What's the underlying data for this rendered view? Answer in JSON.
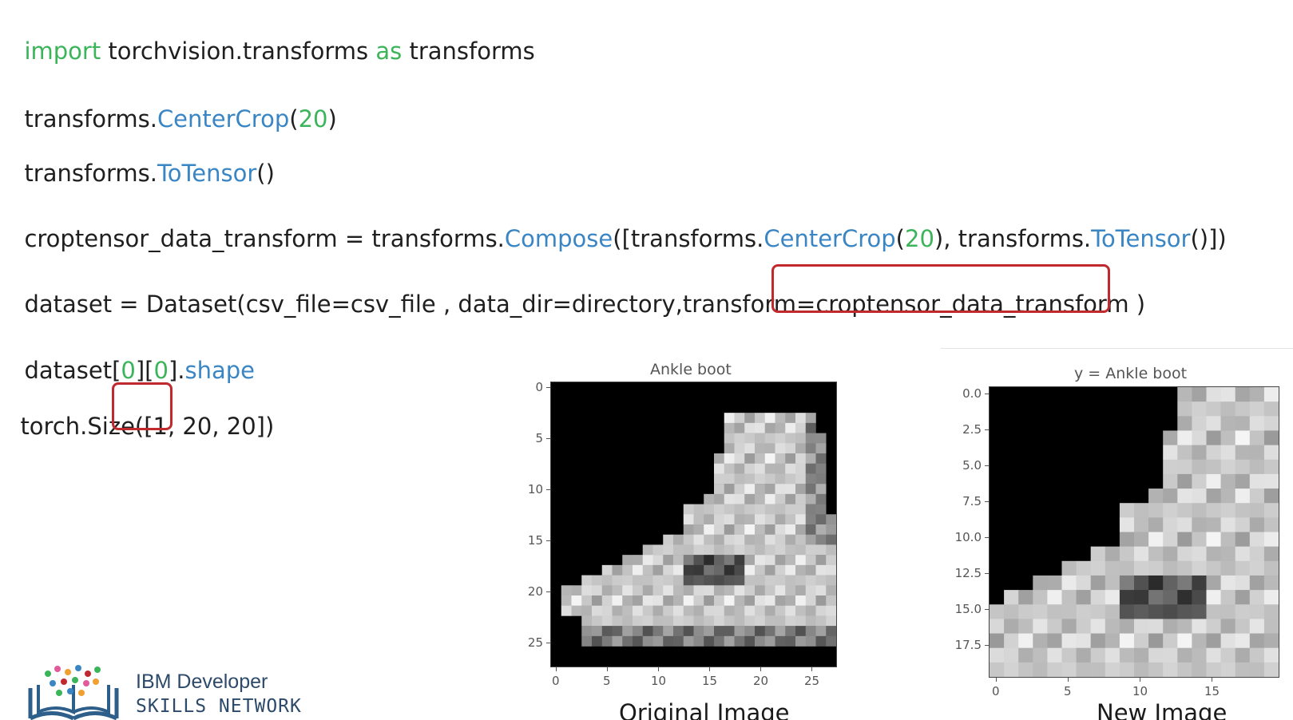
{
  "code": {
    "line1": {
      "kw1": "import",
      "t1": " torchvision.transforms ",
      "kw2": "as",
      "t2": " transforms"
    },
    "line2": {
      "t1": "transforms.",
      "fn": "CenterCrop",
      "p1": "(",
      "num": "20",
      "p2": ")"
    },
    "line3": {
      "t1": "transforms.",
      "fn": "ToTensor",
      "p1": "()"
    },
    "line4": {
      "t1": "croptensor_data_transform = transforms.",
      "fn1": "Compose",
      "t2": "([transforms.",
      "fn2": "CenterCrop",
      "p1": "(",
      "num": "20",
      "t3": "), transforms.",
      "fn3": "ToTensor",
      "t4": "()])"
    },
    "line5": {
      "t1": "dataset = Dataset(csv_file=csv_file , data_dir=directory,transform=croptensor_data_transform )"
    },
    "line6": {
      "t1": "dataset[",
      "n1": "0",
      "t2": "][",
      "n2": "0",
      "t3": "].",
      "attr": "shape"
    },
    "line7": {
      "t1": "torch.Size([1, 20, 20])"
    }
  },
  "plots": {
    "original": {
      "title": "Ankle boot",
      "caption": "Original Image",
      "yticks": [
        "0",
        "5",
        "10",
        "15",
        "20",
        "25"
      ],
      "xticks": [
        "0",
        "5",
        "10",
        "15",
        "20",
        "25"
      ]
    },
    "cropped": {
      "title": "y = Ankle boot",
      "caption": "New Image",
      "yticks": [
        "0.0",
        "2.5",
        "5.0",
        "7.5",
        "10.0",
        "12.5",
        "15.0",
        "17.5"
      ],
      "xticks": [
        "0",
        "5",
        "10",
        "15"
      ]
    }
  },
  "logo": {
    "line1": "IBM Developer",
    "line2": "SKILLS NETWORK",
    "icon": "books-network-icon"
  },
  "colors": {
    "keyword": "#3cb45a",
    "function": "#3a86c4",
    "highlight": "#c0292e"
  }
}
